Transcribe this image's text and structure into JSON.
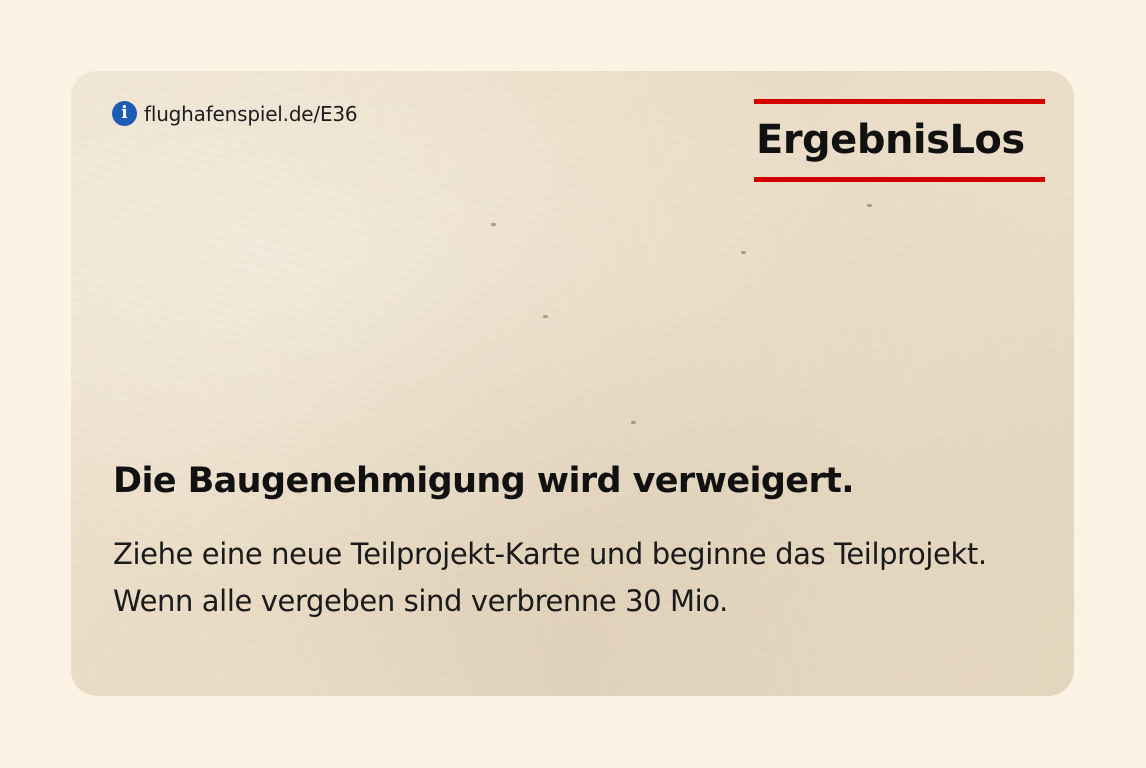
{
  "card": {
    "info": {
      "icon": "info-icon",
      "link_text": "flughafenspiel.de/E36"
    },
    "brand": {
      "title": "ErgebnisLos",
      "accent_color": "#d40000"
    },
    "headline": "Die Baugenehmigung wird verweigert.",
    "body": "Ziehe eine neue Teilprojekt-Karte und beginne das Teilprojekt. Wenn alle vergeben sind verbrenne 30 Mio."
  }
}
